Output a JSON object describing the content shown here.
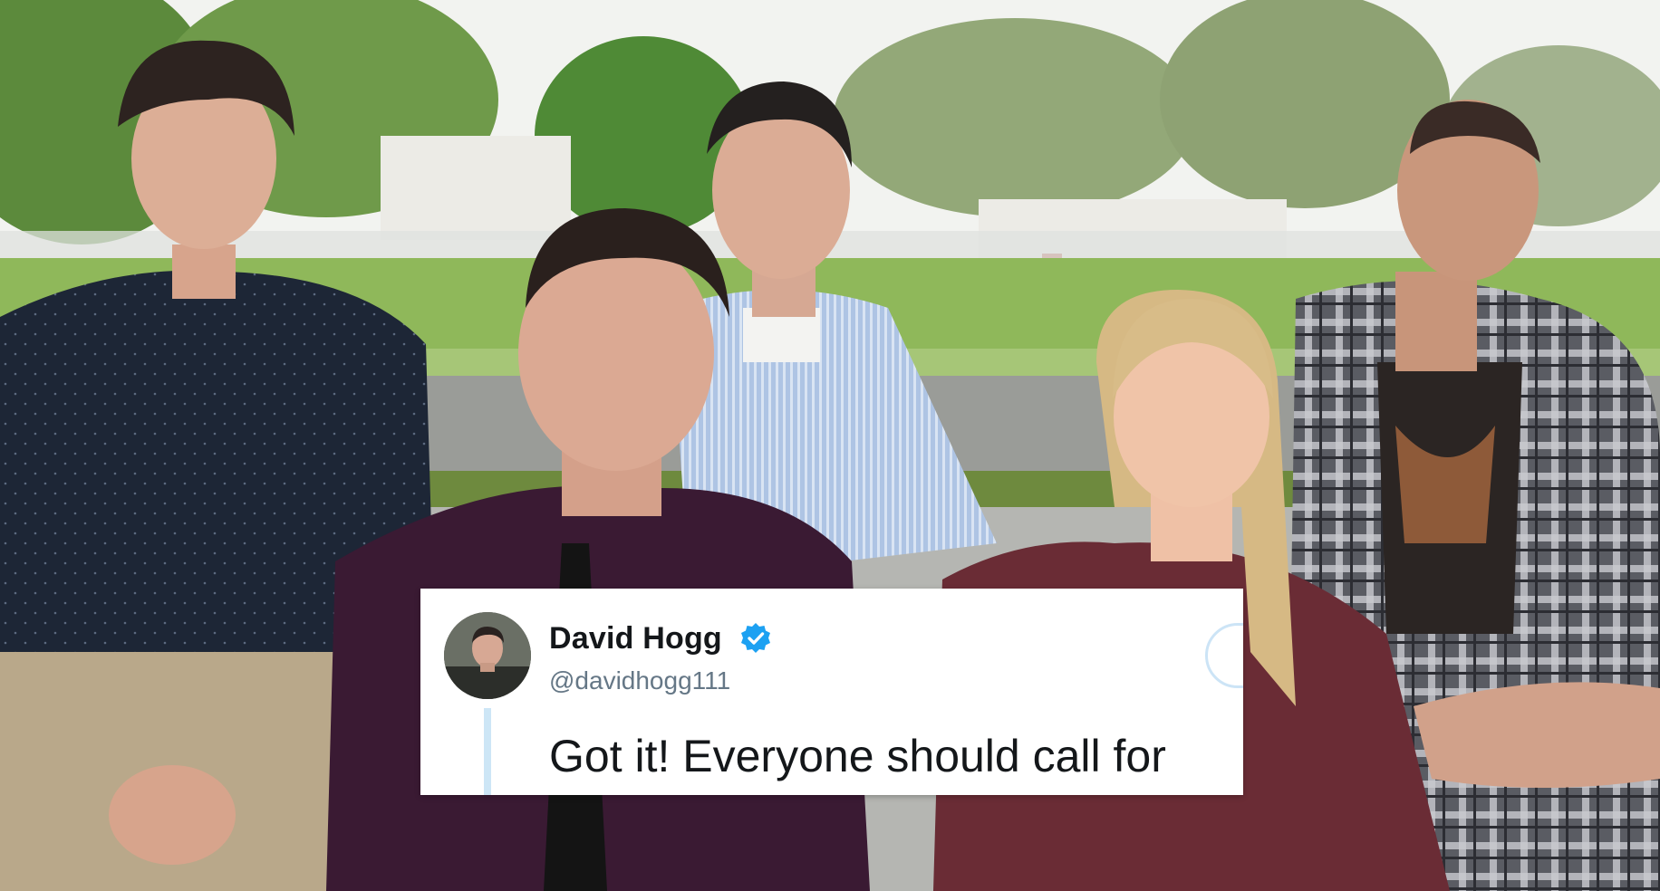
{
  "tweet": {
    "display_name": "David Hogg",
    "handle": "@davidhogg111",
    "text": "Got it! Everyone should call for",
    "verified": true,
    "verified_badge_color": "#1da1f2",
    "avatar_icon": "profile-photo",
    "follow_button_color": "#cce4f6"
  },
  "colors": {
    "sky": "#f2f3f0",
    "grass": "#8fb85a",
    "road": "#9a9c98",
    "tweet_background": "#ffffff",
    "name_text": "#14171a",
    "handle_text": "#657786"
  }
}
